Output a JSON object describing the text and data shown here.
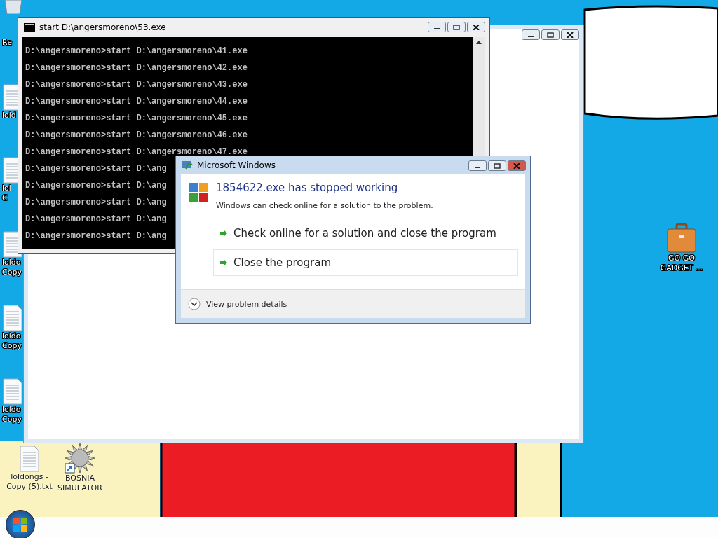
{
  "desktop_icons": [
    {
      "kind": "bin",
      "lines": [
        "Re"
      ]
    },
    {
      "kind": "file",
      "lines": [
        "lold"
      ]
    },
    {
      "kind": "file",
      "lines": [
        "lol",
        "C"
      ]
    },
    {
      "kind": "file",
      "lines": [
        "loldo",
        "Copy"
      ]
    },
    {
      "kind": "file",
      "lines": [
        "loldo",
        "Copy"
      ]
    },
    {
      "kind": "file",
      "lines": [
        "loldo",
        "Copy"
      ]
    }
  ],
  "bottom_icons": [
    {
      "kind": "file",
      "lines": [
        "loldongs -",
        "Copy (5).txt"
      ]
    },
    {
      "kind": "mine",
      "lines": [
        "BOSNIA",
        "SIMULATOR"
      ]
    }
  ],
  "right_icon": {
    "kind": "briefcase",
    "lines": [
      "GO GO",
      "GADGET ..."
    ]
  },
  "console": {
    "title": "start  D:\\angersmoreno\\53.exe",
    "lines": [
      "D:\\angersmoreno>start D:\\angersmoreno\\41.exe",
      "D:\\angersmoreno>start D:\\angersmoreno\\42.exe",
      "D:\\angersmoreno>start D:\\angersmoreno\\43.exe",
      "D:\\angersmoreno>start D:\\angersmoreno\\44.exe",
      "D:\\angersmoreno>start D:\\angersmoreno\\45.exe",
      "D:\\angersmoreno>start D:\\angersmoreno\\46.exe",
      "D:\\angersmoreno>start D:\\angersmoreno\\47.exe",
      "D:\\angersmoreno>start D:\\ang",
      "D:\\angersmoreno>start D:\\ang",
      "D:\\angersmoreno>start D:\\ang",
      "D:\\angersmoreno>start D:\\ang",
      "D:\\angersmoreno>start D:\\ang"
    ]
  },
  "dialog": {
    "title": "Microsoft Windows",
    "heading": "1854622.exe has stopped working",
    "message": "Windows can check online for a solution to the problem.",
    "options": [
      {
        "label": "Check online for a solution and close the program",
        "selected": false
      },
      {
        "label": "Close the program",
        "selected": true
      }
    ],
    "details": "View problem details"
  }
}
